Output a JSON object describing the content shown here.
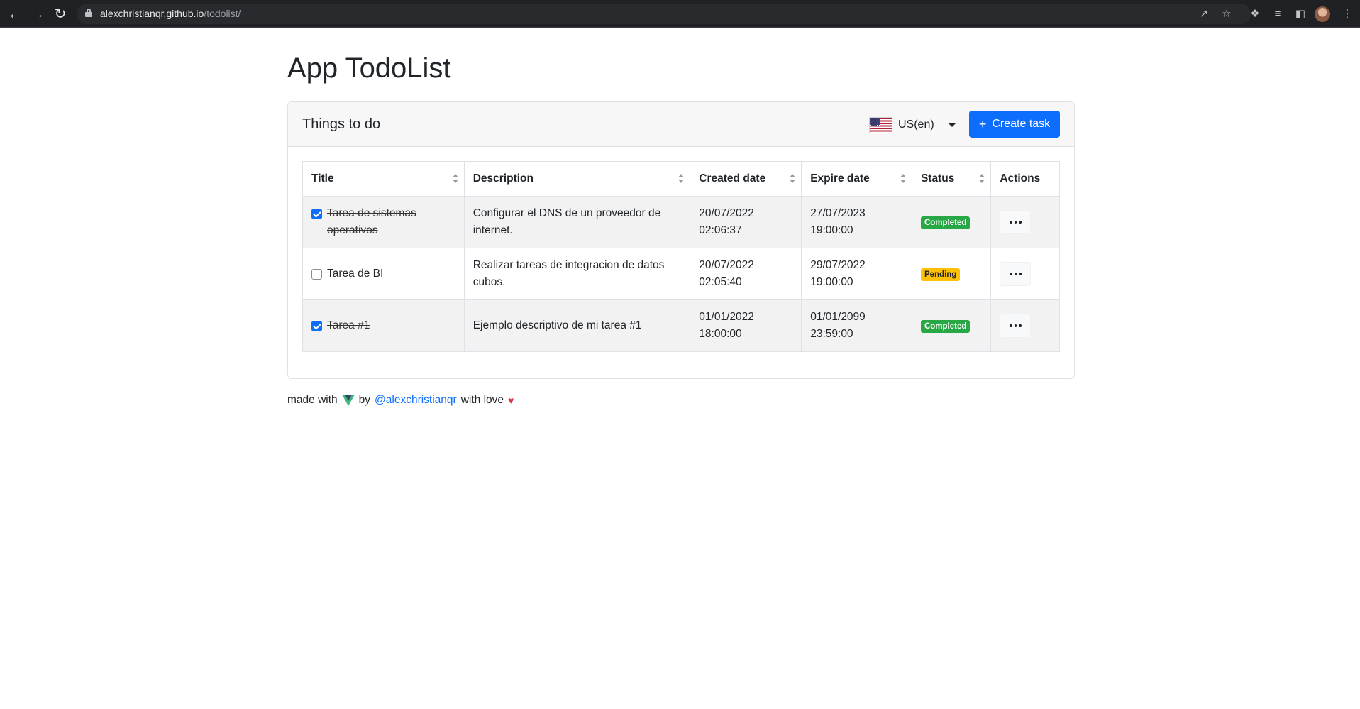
{
  "browser": {
    "url_host": "alexchristianqr.github.io",
    "url_path": "/todolist/"
  },
  "page": {
    "title": "App TodoList"
  },
  "card": {
    "title": "Things to do",
    "language": "US(en)",
    "create_button": "Create task"
  },
  "table": {
    "columns": [
      "Title",
      "Description",
      "Created date",
      "Expire date",
      "Status",
      "Actions"
    ],
    "rows": [
      {
        "checked": true,
        "title": "Tarea de sistemas operativos",
        "description": "Configurar el DNS de un proveedor de internet.",
        "created_date": "20/07/2022",
        "created_time": "02:06:37",
        "expire_date": "27/07/2023",
        "expire_time": "19:00:00",
        "status": "Completed"
      },
      {
        "checked": false,
        "title": "Tarea de BI",
        "description": "Realizar tareas de integracion de datos cubos.",
        "created_date": "20/07/2022",
        "created_time": "02:05:40",
        "expire_date": "29/07/2022",
        "expire_time": "19:00:00",
        "status": "Pending"
      },
      {
        "checked": true,
        "title": "Tarea #1",
        "description": "Ejemplo descriptivo de mi tarea #1",
        "created_date": "01/01/2022",
        "created_time": "18:00:00",
        "expire_date": "01/01/2099",
        "expire_time": "23:59:00",
        "status": "Completed"
      }
    ]
  },
  "footer": {
    "made_with": "made with",
    "by": "by",
    "author": "@alexchristianqr",
    "with_love": "with love"
  },
  "colors": {
    "primary": "#0d6efd",
    "completed": "#28a745",
    "pending": "#ffc107",
    "heart": "#dc3545"
  },
  "icons": [
    "back-arrow-icon",
    "forward-arrow-icon",
    "reload-icon",
    "lock-icon",
    "share-icon",
    "star-icon",
    "extensions-icon",
    "reading-list-icon",
    "side-panel-icon",
    "avatar",
    "kebab-menu-icon",
    "us-flag-icon",
    "caret-down-icon",
    "plus-icon",
    "sort-icon",
    "checkbox",
    "ellipsis-icon",
    "vue-icon",
    "heart-icon"
  ]
}
